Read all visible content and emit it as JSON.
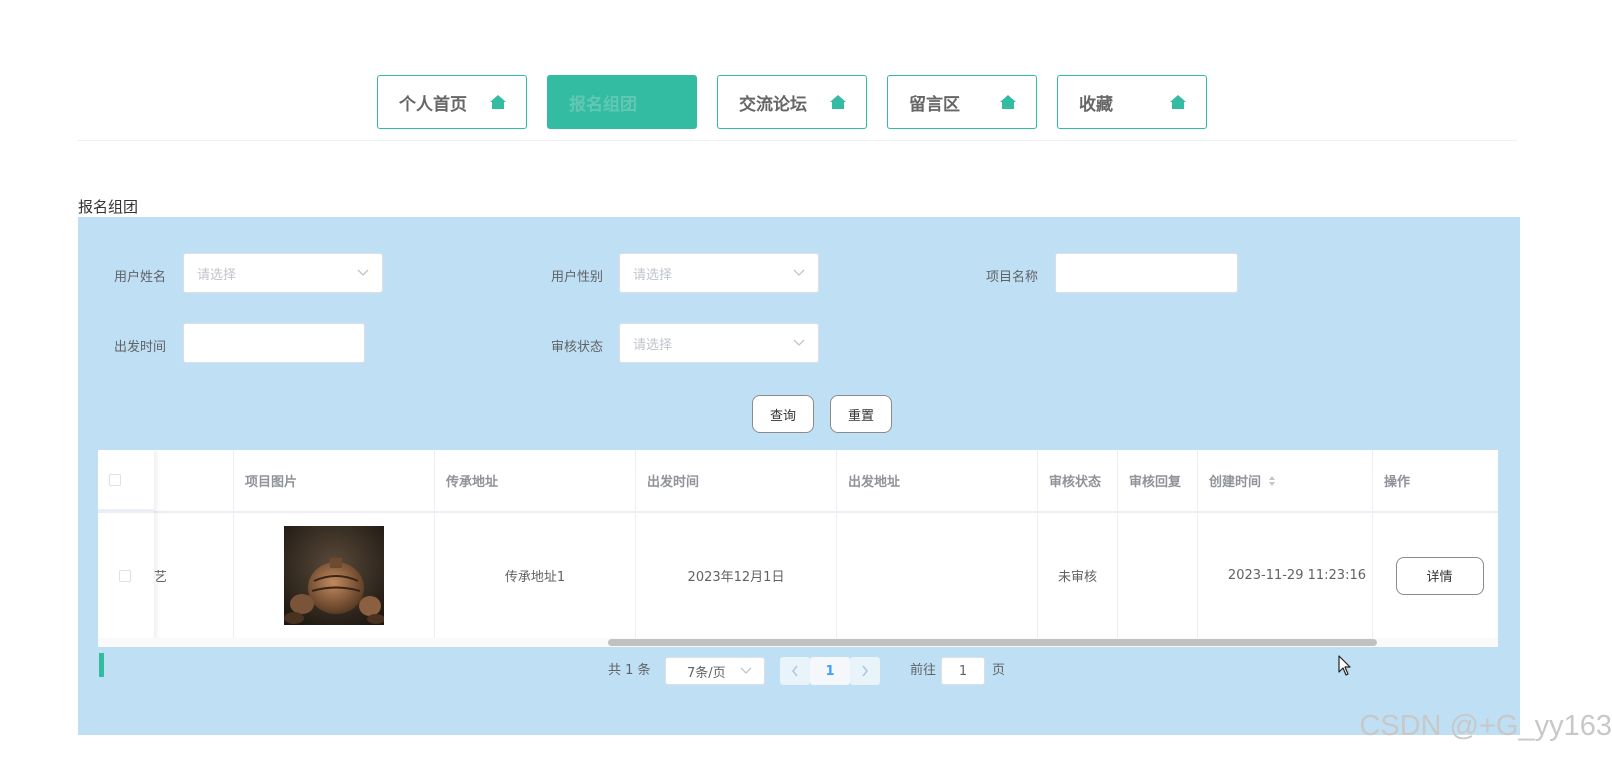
{
  "nav": {
    "tabs": [
      {
        "label": "个人首页",
        "active": false
      },
      {
        "label": "报名组团",
        "active": true
      },
      {
        "label": "交流论坛",
        "active": false
      },
      {
        "label": "留言区",
        "active": false
      },
      {
        "label": "收藏",
        "active": false
      }
    ],
    "icon": "home-icon"
  },
  "page_title": "报名组团",
  "filters": {
    "user_name": {
      "label": "用户姓名",
      "placeholder": "请选择"
    },
    "user_gender": {
      "label": "用户性别",
      "placeholder": "请选择"
    },
    "project_name": {
      "label": "项目名称",
      "value": ""
    },
    "depart_time": {
      "label": "出发时间",
      "value": ""
    },
    "review_status": {
      "label": "审核状态",
      "placeholder": "请选择"
    }
  },
  "buttons": {
    "query": "查询",
    "reset": "重置"
  },
  "table": {
    "headers": [
      "项目图片",
      "传承地址",
      "出发时间",
      "出发地址",
      "审核状态",
      "审核回复",
      "创建时间",
      "操作"
    ],
    "rows": [
      {
        "first_col_fragment": "艺",
        "project_image": "pottery-photo",
        "heritage_address": "传承地址1",
        "depart_time": "2023年12月1日",
        "depart_address": "",
        "review_status": "未审核",
        "review_reply": "",
        "created_at": "2023-11-29 11:23:16",
        "action": "详情"
      }
    ]
  },
  "pagination": {
    "total": "共 1 条",
    "page_size": "7条/页",
    "current_page": "1",
    "goto_label": "前往",
    "goto_value": "1",
    "page_suffix": "页"
  },
  "watermark": "CSDN @+G_yy163",
  "colors": {
    "accent": "#33bca2",
    "panel": "#bfe0f4",
    "border": "#dcdfe6"
  }
}
